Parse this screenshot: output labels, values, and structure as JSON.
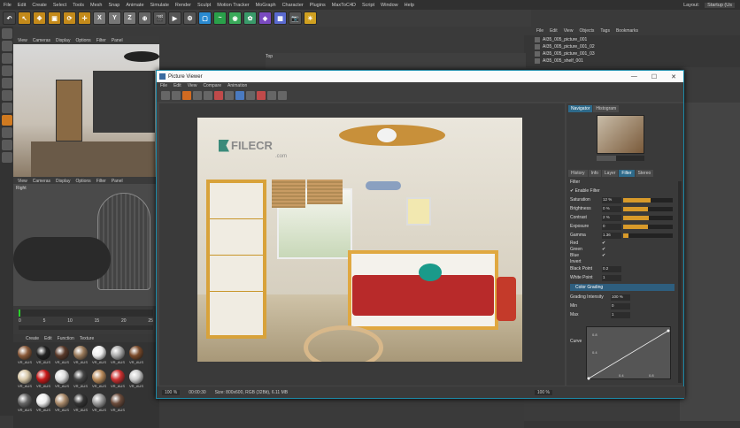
{
  "menubar": [
    "File",
    "Edit",
    "Create",
    "Select",
    "Tools",
    "Mesh",
    "Snap",
    "Animate",
    "Simulate",
    "Render",
    "Sculpt",
    "Motion Tracker",
    "MoGraph",
    "Character",
    "Plugins",
    "MaxToC4D",
    "Script",
    "Window",
    "Help"
  ],
  "menubar_right": [
    "Layout:",
    "Startup (Us"
  ],
  "viewport_menu": [
    "View",
    "Cameras",
    "Display",
    "Options",
    "Filter",
    "Panel"
  ],
  "viewport2_label": "Right",
  "timeline_ticks": [
    "0",
    "5",
    "10",
    "15",
    "20",
    "25"
  ],
  "material_menu": [
    "Create",
    "Edit",
    "Function",
    "Texture"
  ],
  "material_label": "VR_AUS",
  "object_menu": [
    "File",
    "Edit",
    "View",
    "Objects",
    "Tags",
    "Bookmarks"
  ],
  "objects": [
    "AI35_005_picture_001",
    "AI35_005_picture_001_02",
    "AI35_005_picture_001_03",
    "AI35_005_shelf_001"
  ],
  "top_label": "Top",
  "picture_viewer": {
    "title": "Picture Viewer",
    "menu": [
      "File",
      "Edit",
      "View",
      "Compare",
      "Animation"
    ],
    "status": [
      "100 %",
      "00:00:30",
      "Size: 800x600, RGB (32Bit), 6.11 MB"
    ],
    "status_right": "100 %",
    "tabs_top": [
      "Navigator",
      "Histogram"
    ],
    "tabs_mid": [
      "History",
      "Info",
      "Layer",
      "Filter",
      "Stereo"
    ],
    "filter_title": "Filter",
    "enable_filter": "Enable Filter",
    "params": [
      {
        "name": "Saturation",
        "value": "12 %",
        "fill": 0.55
      },
      {
        "name": "Brightness",
        "value": "0 %",
        "fill": 0.5
      },
      {
        "name": "Contrast",
        "value": "2 %",
        "fill": 0.52
      },
      {
        "name": "Exposure",
        "value": "0",
        "fill": 0.5
      },
      {
        "name": "Gamma",
        "value": "1.36",
        "fill": 0.1
      }
    ],
    "checks": [
      "Red",
      "Green",
      "Blue",
      "Invert"
    ],
    "black_point": {
      "name": "Black Point",
      "value": "0.2"
    },
    "white_point": {
      "name": "White Point",
      "value": "1"
    },
    "color_grading": "Color Grading",
    "grading": [
      {
        "name": "Grading Intensity",
        "value": "100 %"
      },
      {
        "name": "Min",
        "value": "0"
      },
      {
        "name": "Max",
        "value": "1"
      }
    ],
    "curve_label": "Curve",
    "curve_ticks": [
      "0.8",
      "0.4",
      "0.4",
      "0.8"
    ],
    "watermark": "FILECR",
    "watermark_sub": ".com"
  },
  "colors": {
    "accent": "#2e6a8a",
    "orange": "#d89a2a",
    "border": "#1c8aa8"
  }
}
